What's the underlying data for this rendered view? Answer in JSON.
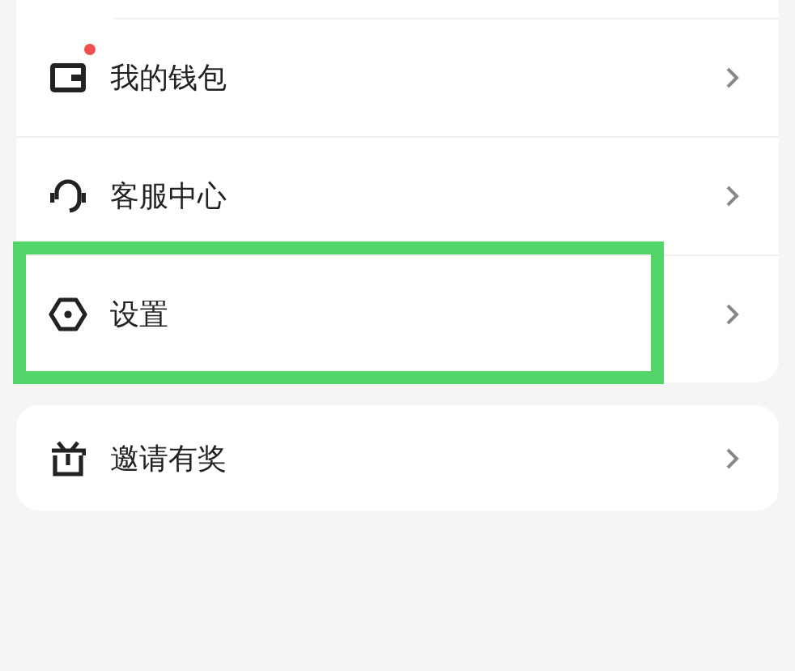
{
  "groups": [
    {
      "items": [
        {
          "kind": "wallet",
          "label": "我的钱包",
          "dot": true,
          "highlighted": false
        },
        {
          "kind": "headset",
          "label": "客服中心",
          "dot": false,
          "highlighted": false
        },
        {
          "kind": "hexagon",
          "label": "设置",
          "dot": false,
          "highlighted": true
        }
      ]
    },
    {
      "items": [
        {
          "kind": "gift",
          "label": "邀请有奖",
          "dot": false,
          "highlighted": false
        }
      ]
    }
  ]
}
